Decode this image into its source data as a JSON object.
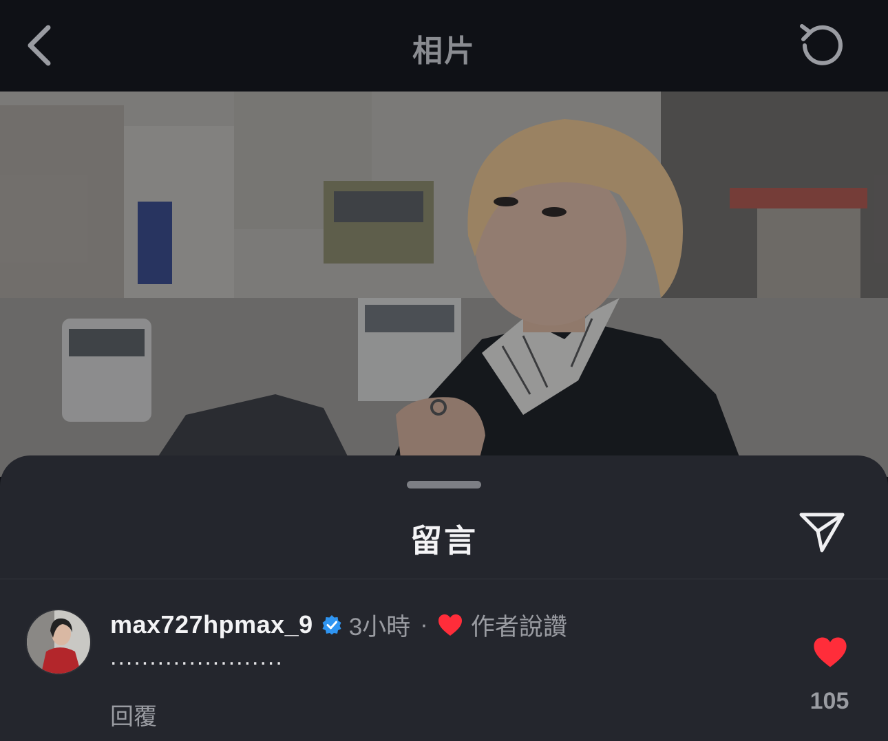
{
  "header": {
    "title": "相片",
    "back_icon": "chevron-left-icon",
    "refresh_icon": "refresh-icon"
  },
  "photo": {
    "description_icon": "photo-image"
  },
  "comments_sheet": {
    "title": "留言",
    "share_icon": "send-icon"
  },
  "comment": {
    "username": "max727hpmax_9",
    "time": "3小時",
    "separator": "·",
    "author_liked": "作者說讚",
    "text": "......................",
    "reply_label": "回覆",
    "like_count": "105"
  },
  "colors": {
    "like_red": "#ff2d3a",
    "verified_blue": "#2f95f2",
    "sheet_bg": "#24262d"
  }
}
